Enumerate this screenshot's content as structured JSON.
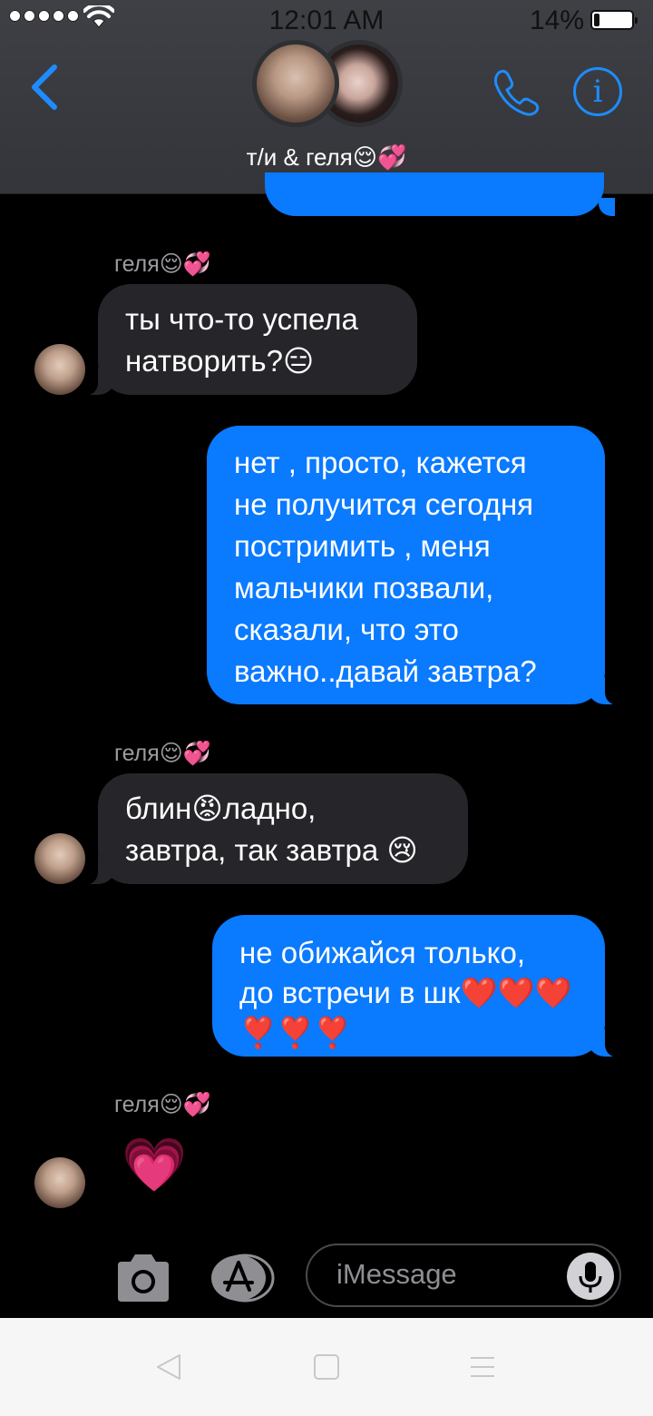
{
  "status_bar": {
    "time": "12:01 AM",
    "battery_percent": "14%",
    "battery_level": 0.14,
    "signal_bars": 5
  },
  "header": {
    "chat_name": "т/и & геля😌💞"
  },
  "messages": [
    {
      "side": "incoming",
      "sender": "геля😌💞",
      "text": "ты что-то успела\nнатворить?😑"
    },
    {
      "side": "outgoing",
      "text": "нет , просто, кажется\nне получится сегодня\nпостримить , меня\nмальчики позвали,\nсказали, что это\nважно..давай завтра?"
    },
    {
      "side": "incoming",
      "sender": "геля😌💞",
      "text": "блин😡ладно,\nзавтра, так завтра 😢"
    },
    {
      "side": "outgoing",
      "text": "не обижайся только,\nдо встречи в шк❤️❤️❤️\n❣️❣️❣️"
    },
    {
      "side": "incoming",
      "sender": "геля😌💞",
      "text": "💗"
    }
  ],
  "input": {
    "placeholder": "iMessage"
  },
  "colors": {
    "outgoing_bubble": "#0a7aff",
    "incoming_bubble": "#26252a",
    "accent": "#1d8cff"
  }
}
